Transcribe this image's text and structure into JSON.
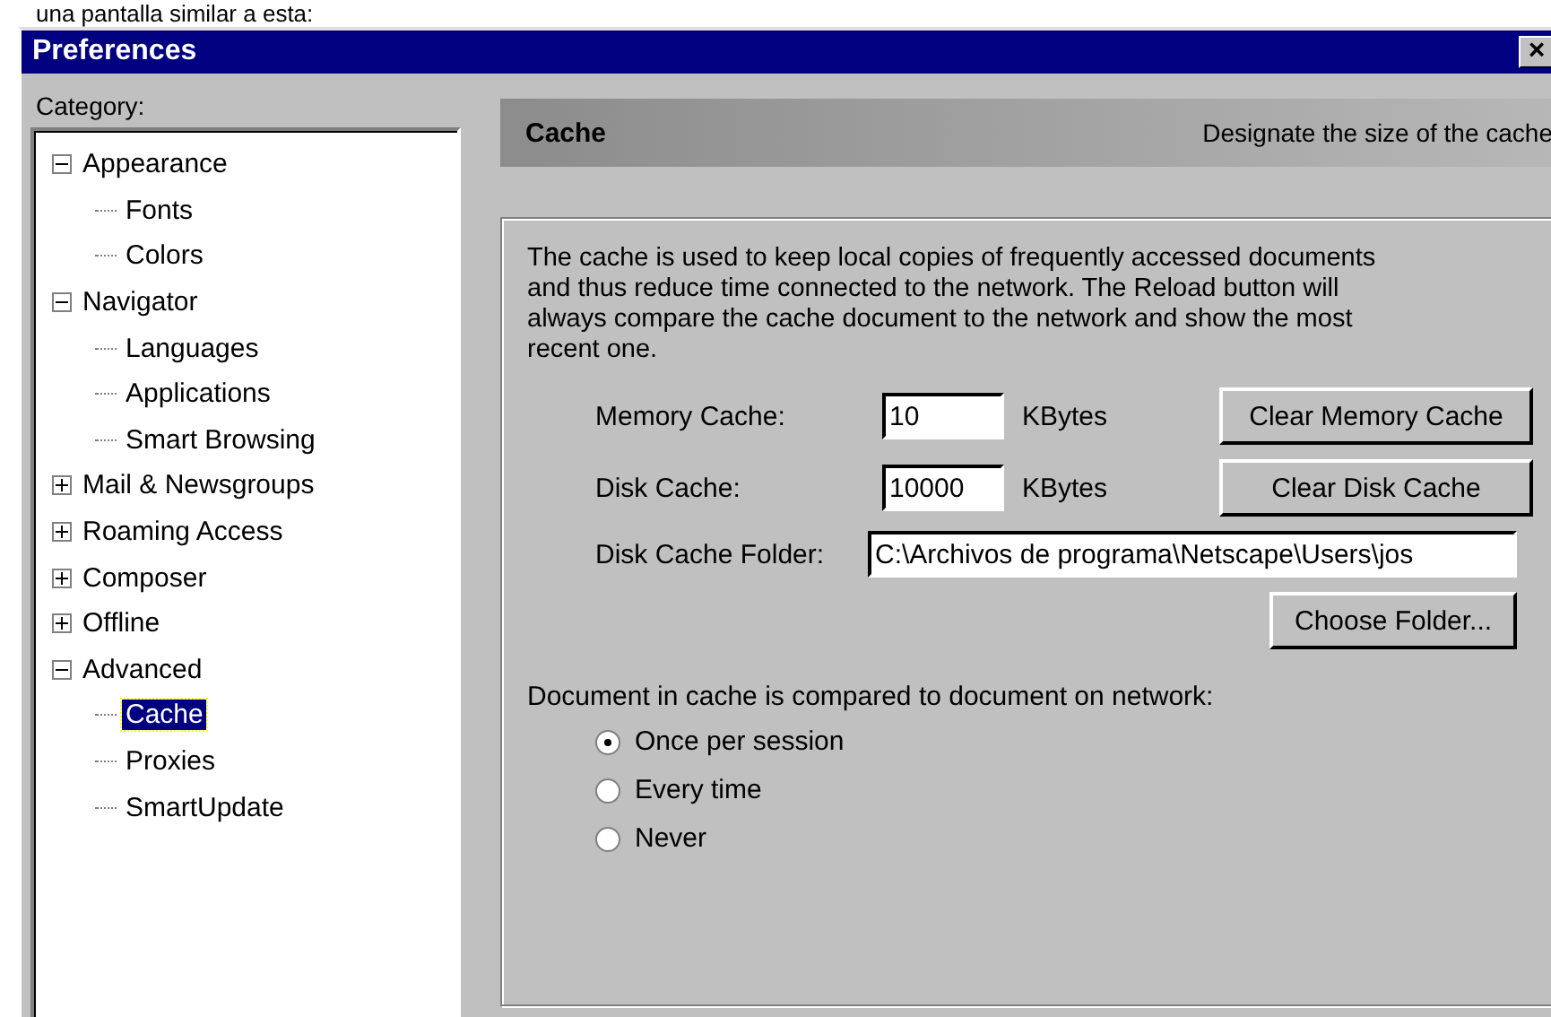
{
  "caption": "una pantalla similar a esta:",
  "window": {
    "title": "Preferences",
    "close": "×"
  },
  "category_label": "Category:",
  "tree": [
    {
      "label": "Appearance",
      "expanded": true,
      "selected": false,
      "children": [
        {
          "label": "Fonts",
          "selected": false
        },
        {
          "label": "Colors",
          "selected": false
        }
      ]
    },
    {
      "label": "Navigator",
      "expanded": true,
      "selected": false,
      "children": [
        {
          "label": "Languages",
          "selected": false
        },
        {
          "label": "Applications",
          "selected": false
        },
        {
          "label": "Smart Browsing",
          "selected": false
        }
      ]
    },
    {
      "label": "Mail & Newsgroups",
      "expanded": false,
      "selected": false
    },
    {
      "label": "Roaming Access",
      "expanded": false,
      "selected": false
    },
    {
      "label": "Composer",
      "expanded": false,
      "selected": false
    },
    {
      "label": "Offline",
      "expanded": false,
      "selected": false
    },
    {
      "label": "Advanced",
      "expanded": true,
      "selected": false,
      "children": [
        {
          "label": "Cache",
          "selected": true
        },
        {
          "label": "Proxies",
          "selected": false
        },
        {
          "label": "SmartUpdate",
          "selected": false
        }
      ]
    }
  ],
  "header": {
    "title": "Cache",
    "subtitle": "Designate the size of the cache"
  },
  "description": "The cache is used to keep local copies of frequently accessed documents and thus reduce time connected to the network. The Reload button will always compare the cache document to the network and show the most recent one.",
  "memory_cache": {
    "label": "Memory Cache:",
    "value": "10",
    "unit": "KBytes",
    "button": "Clear Memory Cache"
  },
  "disk_cache": {
    "label": "Disk Cache:",
    "value": "10000",
    "unit": "KBytes",
    "button": "Clear Disk Cache"
  },
  "folder": {
    "label": "Disk Cache Folder:",
    "value": "C:\\Archivos de programa\\Netscape\\Users\\jos",
    "button": "Choose Folder..."
  },
  "compare_label": "Document in cache is compared to document on network:",
  "compare_options": [
    {
      "label": "Once per session",
      "selected": true
    },
    {
      "label": "Every time",
      "selected": false
    },
    {
      "label": "Never",
      "selected": false
    }
  ]
}
